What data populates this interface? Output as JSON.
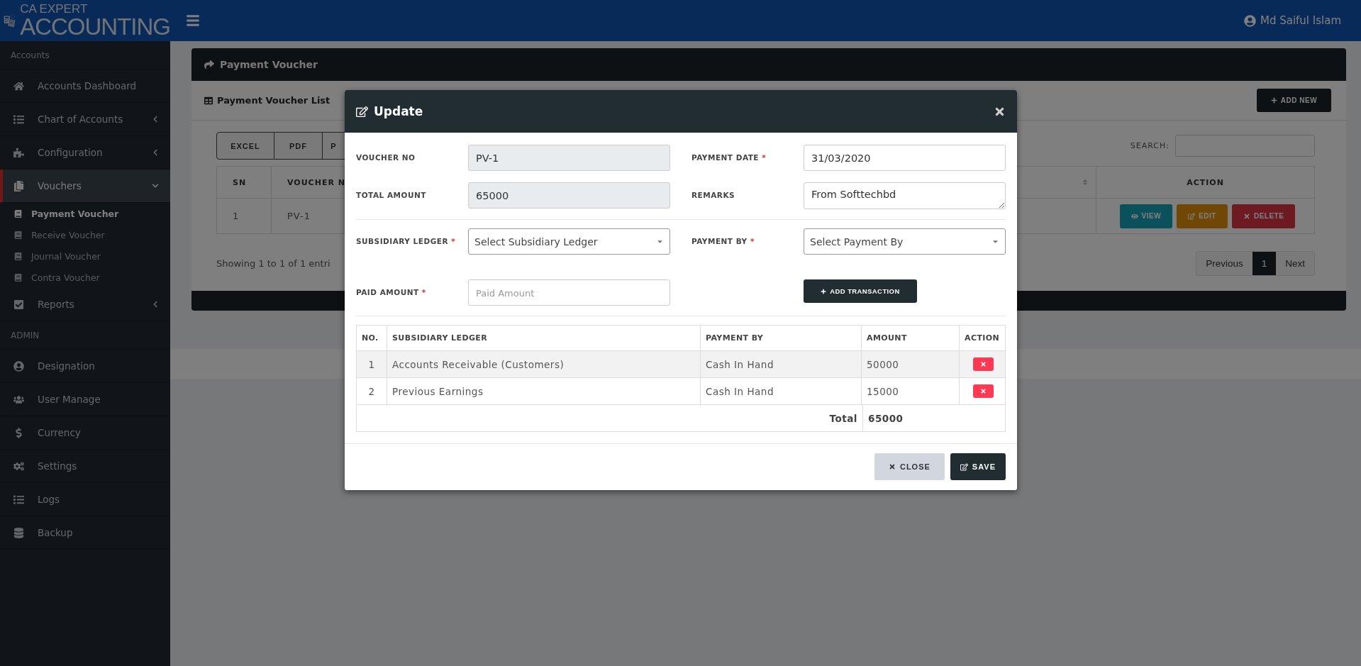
{
  "header": {
    "logo_line1": "CA EXPERT",
    "logo_line2": "ACCOUNTING",
    "user_name": "Md Saiful Islam"
  },
  "sidebar": {
    "sections": [
      {
        "label": "Accounts",
        "items": [
          {
            "label": "Accounts Dashboard",
            "selected": false
          },
          {
            "label": "Chart of Accounts",
            "selected": false,
            "expanded": false
          },
          {
            "label": "Configuration",
            "selected": false,
            "expanded": false
          },
          {
            "label": "Vouchers",
            "selected": true,
            "expanded": true,
            "children": [
              {
                "label": "Payment Voucher",
                "selected": true
              },
              {
                "label": "Receive Voucher",
                "selected": false
              },
              {
                "label": "Journal Voucher",
                "selected": false
              },
              {
                "label": "Contra Voucher",
                "selected": false
              }
            ]
          },
          {
            "label": "Reports",
            "selected": false,
            "expanded": false
          }
        ]
      },
      {
        "label": "ADMIN",
        "items": [
          {
            "label": "Designation",
            "selected": false
          },
          {
            "label": "User Manage",
            "selected": false
          },
          {
            "label": "Currency",
            "selected": false
          },
          {
            "label": "Settings",
            "selected": false
          },
          {
            "label": "Logs",
            "selected": false
          },
          {
            "label": "Backup",
            "selected": false
          }
        ]
      }
    ]
  },
  "page": {
    "title": "Payment Voucher",
    "list_title": "Payment Voucher List",
    "add_button": "ADD NEW",
    "export_buttons": [
      "EXCEL",
      "PDF",
      "P"
    ],
    "search_label": "SEARCH:",
    "columns_left": [
      "SN",
      "VOUCHER N"
    ],
    "columns_right": [
      "ACTION"
    ],
    "rows": [
      {
        "sn": "1",
        "voucher": "PV-1",
        "actions": [
          {
            "kind": "view",
            "label": "VIEW"
          },
          {
            "kind": "edit",
            "label": "EDIT"
          },
          {
            "kind": "delete",
            "label": "DELETE"
          }
        ]
      }
    ],
    "info": "Showing 1 to 1 of 1 entri",
    "pagination": [
      {
        "label": "Previous",
        "selected": false
      },
      {
        "label": "1",
        "selected": true
      },
      {
        "label": "Next",
        "selected": false
      }
    ]
  },
  "modal": {
    "title": "Update",
    "groups": [
      {
        "rows": [
          [
            {
              "kind": "readonly",
              "label": "VOUCHER NO",
              "value": "PV-1"
            },
            {
              "kind": "input",
              "label": "PAYMENT DATE",
              "required_mark": "*",
              "value": "31/03/2020"
            }
          ],
          [
            {
              "kind": "readonly",
              "label": "TOTAL AMOUNT",
              "value": "65000"
            },
            {
              "kind": "textarea",
              "label": "REMARKS",
              "value": "From Softtechbd"
            }
          ]
        ]
      },
      {
        "rows": [
          [
            {
              "kind": "select",
              "label": "SUBSIDIARY LEDGER",
              "required_mark": "*",
              "placeholder": "Select Subsidiary Ledger"
            },
            {
              "kind": "select",
              "label": "PAYMENT BY",
              "required_mark": "*",
              "placeholder": "Select Payment By"
            }
          ],
          [
            {
              "kind": "input",
              "label": "PAID AMOUNT",
              "required_mark": "*",
              "placeholder": "Paid Amount"
            },
            {
              "kind": "button",
              "label": "ADD TRANSACTION"
            }
          ]
        ]
      }
    ],
    "table": {
      "columns": [
        "NO.",
        "SUBSIDIARY LEDGER",
        "PAYMENT BY",
        "AMOUNT",
        "ACTION"
      ],
      "rows": [
        {
          "no": "1",
          "ledger": "Accounts Receivable (Customers)",
          "payment_by": "Cash In Hand",
          "amount": "50000"
        },
        {
          "no": "2",
          "ledger": "Previous Earnings",
          "payment_by": "Cash In Hand",
          "amount": "15000"
        }
      ],
      "total_label": "Total",
      "total_value": "65000"
    },
    "buttons": [
      {
        "kind": "close",
        "label": "CLOSE"
      },
      {
        "kind": "save",
        "label": "SAVE"
      }
    ]
  }
}
